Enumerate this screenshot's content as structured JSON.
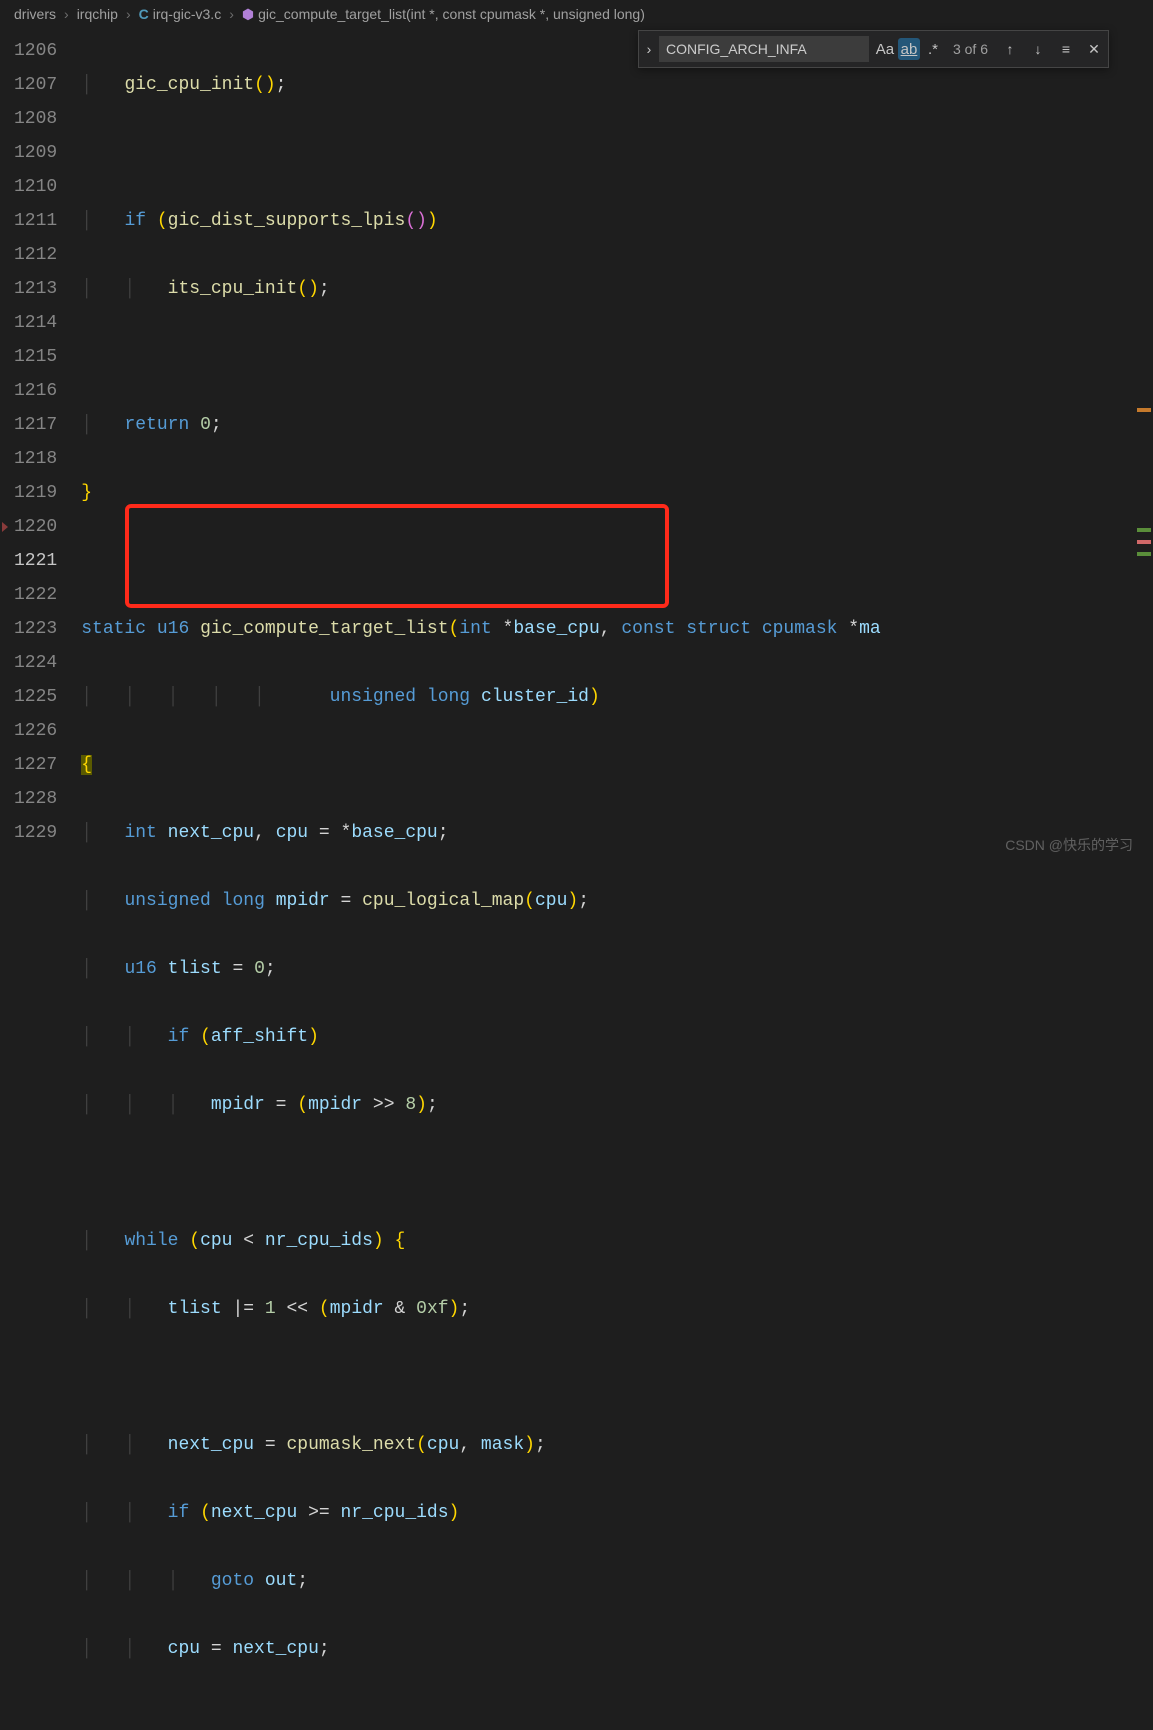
{
  "breadcrumb": {
    "folder1": "drivers",
    "folder2": "irqchip",
    "file": "irq-gic-v3.c",
    "symbol": "gic_compute_target_list(int *, const cpumask *, unsigned long)"
  },
  "find": {
    "query": "CONFIG_ARCH_INFA",
    "case_label": "Aa",
    "word_label": "ab",
    "regex_label": ".*",
    "results": "3 of 6"
  },
  "lines": {
    "start": 1206,
    "end": 1229,
    "current": 1221
  },
  "code": {
    "l1206": "gic_cpu_init",
    "l1208_if": "if",
    "l1208_fn": "gic_dist_supports_lpis",
    "l1209_fn": "its_cpu_init",
    "l1211_ret": "return",
    "l1211_val": "0",
    "l1214_static": "static",
    "l1214_u16": "u16",
    "l1214_fn": "gic_compute_target_list",
    "l1214_int": "int",
    "l1214_p1": "base_cpu",
    "l1214_const": "const",
    "l1214_struct": "struct",
    "l1214_cpumask": "cpumask",
    "l1214_ma": "ma",
    "l1215_ul": "unsigned",
    "l1215_long": "long",
    "l1215_id": "cluster_id",
    "l1217_int": "int",
    "l1217_v1": "next_cpu",
    "l1217_v2": "cpu",
    "l1217_v3": "base_cpu",
    "l1218_ul": "unsigned",
    "l1218_long": "long",
    "l1218_v": "mpidr",
    "l1218_fn": "cpu_logical_map",
    "l1218_arg": "cpu",
    "l1219_u16": "u16",
    "l1219_v": "tlist",
    "l1219_val": "0",
    "l1220_if": "if",
    "l1220_cond": "aff_shift",
    "l1221_lhs": "mpidr",
    "l1221_rhs": "mpidr",
    "l1221_shift": "8",
    "l1223_while": "while",
    "l1223_lhs": "cpu",
    "l1223_rhs": "nr_cpu_ids",
    "l1224_v": "tlist",
    "l1224_one": "1",
    "l1224_m": "mpidr",
    "l1224_hex": "0xf",
    "l1226_v": "next_cpu",
    "l1226_fn": "cpumask_next",
    "l1226_a1": "cpu",
    "l1226_a2": "mask",
    "l1227_if": "if",
    "l1227_lhs": "next_cpu",
    "l1227_rhs": "nr_cpu_ids",
    "l1228_goto": "goto",
    "l1228_lbl": "out",
    "l1229_lhs": "cpu",
    "l1229_rhs": "next_cpu"
  },
  "watermark": "CSDN @快乐的学习"
}
